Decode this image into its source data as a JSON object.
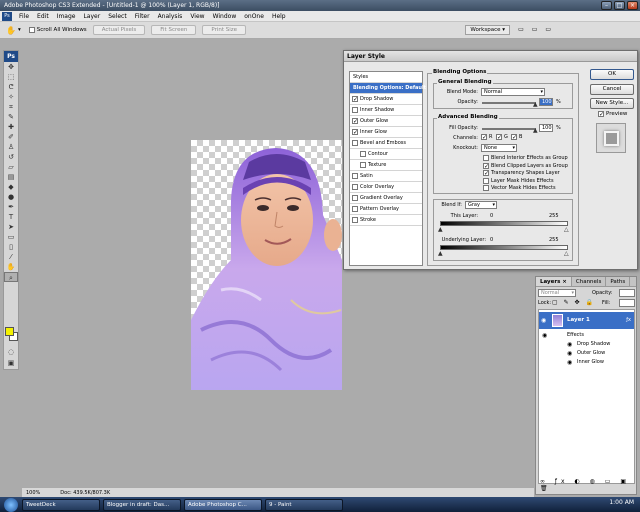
{
  "window": {
    "title": "Adobe Photoshop CS3 Extended - [Untitled-1 @ 100% (Layer 1, RGB/8)]"
  },
  "menu": [
    "File",
    "Edit",
    "Image",
    "Layer",
    "Select",
    "Filter",
    "Analysis",
    "View",
    "Window",
    "onOne",
    "Help"
  ],
  "options_bar": {
    "scroll_all": "Scroll All Windows",
    "buttons": [
      "Actual Pixels",
      "Fit Screen",
      "Print Size"
    ],
    "workspace": "Workspace ▾"
  },
  "toolbox": {
    "logo": "Ps"
  },
  "doc_status": {
    "zoom": "100%",
    "doc": "Doc: 439.5K/807.3K"
  },
  "layer_style": {
    "title": "Layer Style",
    "styles_header": "Styles",
    "styles": [
      {
        "label": "Blending Options: Default",
        "selected": true,
        "checkable": false,
        "checked": false,
        "indent": false
      },
      {
        "label": "Drop Shadow",
        "selected": false,
        "checkable": true,
        "checked": true,
        "indent": false
      },
      {
        "label": "Inner Shadow",
        "selected": false,
        "checkable": true,
        "checked": false,
        "indent": false
      },
      {
        "label": "Outer Glow",
        "selected": false,
        "checkable": true,
        "checked": true,
        "indent": false
      },
      {
        "label": "Inner Glow",
        "selected": false,
        "checkable": true,
        "checked": true,
        "indent": false
      },
      {
        "label": "Bevel and Emboss",
        "selected": false,
        "checkable": true,
        "checked": false,
        "indent": false
      },
      {
        "label": "Contour",
        "selected": false,
        "checkable": true,
        "checked": false,
        "indent": true
      },
      {
        "label": "Texture",
        "selected": false,
        "checkable": true,
        "checked": false,
        "indent": true
      },
      {
        "label": "Satin",
        "selected": false,
        "checkable": true,
        "checked": false,
        "indent": false
      },
      {
        "label": "Color Overlay",
        "selected": false,
        "checkable": true,
        "checked": false,
        "indent": false
      },
      {
        "label": "Gradient Overlay",
        "selected": false,
        "checkable": true,
        "checked": false,
        "indent": false
      },
      {
        "label": "Pattern Overlay",
        "selected": false,
        "checkable": true,
        "checked": false,
        "indent": false
      },
      {
        "label": "Stroke",
        "selected": false,
        "checkable": true,
        "checked": false,
        "indent": false
      }
    ],
    "blending_options_title": "Blending Options",
    "general": {
      "title": "General Blending",
      "blend_mode_label": "Blend Mode:",
      "blend_mode": "Normal",
      "opacity_label": "Opacity:",
      "opacity": "100",
      "opacity_unit": "%"
    },
    "advanced": {
      "title": "Advanced Blending",
      "fill_opacity_label": "Fill Opacity:",
      "fill_opacity": "100",
      "fill_unit": "%",
      "channels_label": "Channels:",
      "channels": [
        "R",
        "G",
        "B"
      ],
      "knockout_label": "Knockout:",
      "knockout": "None",
      "options": [
        {
          "label": "Blend Interior Effects as Group",
          "checked": false
        },
        {
          "label": "Blend Clipped Layers as Group",
          "checked": true
        },
        {
          "label": "Transparency Shapes Layer",
          "checked": true
        },
        {
          "label": "Layer Mask Hides Effects",
          "checked": false
        },
        {
          "label": "Vector Mask Hides Effects",
          "checked": false
        }
      ]
    },
    "blend_if": {
      "label": "Blend If:",
      "value": "Gray",
      "this_layer_label": "This Layer:",
      "this_layer_min": "0",
      "this_layer_max": "255",
      "underlying_label": "Underlying Layer:",
      "underlying_min": "0",
      "underlying_max": "255"
    },
    "buttons": {
      "ok": "OK",
      "cancel": "Cancel",
      "new_style": "New Style...",
      "preview": "Preview"
    }
  },
  "layers_panel": {
    "tabs": [
      "Layers ×",
      "Channels",
      "Paths"
    ],
    "blend_mode": "Normal",
    "opacity_label": "Opacity:",
    "lock_label": "Lock:",
    "fill_label": "Fill:",
    "layer_name": "Layer 1",
    "effects_label": "Effects",
    "effects": [
      "Drop Shadow",
      "Outer Glow",
      "Inner Glow"
    ]
  },
  "taskbar": {
    "items": [
      "TweetDeck",
      "Blogger in draft: Das...",
      "Adobe Photoshop C...",
      "9 - Paint"
    ],
    "clock": "1:00 AM"
  },
  "colors": {
    "accent": "#3a6fc6",
    "foreground_swatch": "#f4f200"
  }
}
